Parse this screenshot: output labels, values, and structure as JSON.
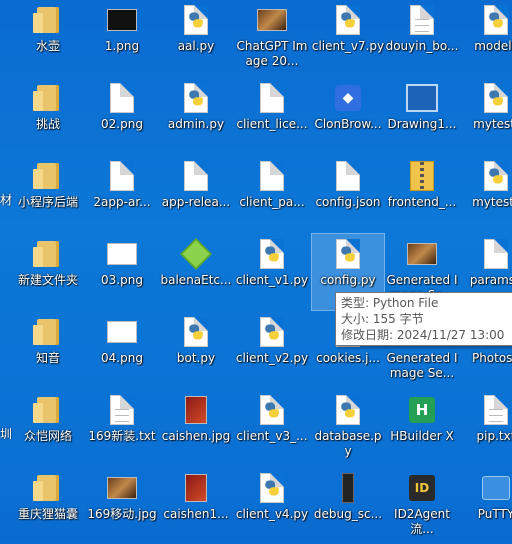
{
  "desktop": {
    "icons": [
      {
        "label": "水壶",
        "icon": "folder-icon",
        "type": "folder"
      },
      {
        "label": "1.png",
        "icon": "image-icon",
        "type": "img-dark"
      },
      {
        "label": "aal.py",
        "icon": "python-file-icon",
        "type": "py"
      },
      {
        "label": "ChatGPT Image 20...",
        "icon": "image-icon",
        "type": "img-photo"
      },
      {
        "label": "client_v7.py",
        "icon": "python-file-icon",
        "type": "py"
      },
      {
        "label": "douyin_bo...",
        "icon": "text-file-icon",
        "type": "doc-lines"
      },
      {
        "label": "models",
        "icon": "python-file-icon",
        "type": "py"
      },
      {
        "label": "挑战",
        "icon": "folder-icon",
        "type": "folder"
      },
      {
        "label": "02.png",
        "icon": "image-icon",
        "type": "doc"
      },
      {
        "label": "admin.py",
        "icon": "python-file-icon",
        "type": "py"
      },
      {
        "label": "client_lice...",
        "icon": "file-icon",
        "type": "doc"
      },
      {
        "label": "ClonBrow...",
        "icon": "app-icon",
        "type": "app-blue"
      },
      {
        "label": "Drawing1...",
        "icon": "drawing-file-icon",
        "type": "dwg"
      },
      {
        "label": "mytest.",
        "icon": "python-file-icon",
        "type": "py"
      },
      {
        "label": "小程序后端",
        "icon": "folder-icon",
        "type": "folder"
      },
      {
        "label": "2app-ar...",
        "icon": "file-icon",
        "type": "doc"
      },
      {
        "label": "app-relea...",
        "icon": "file-icon",
        "type": "doc"
      },
      {
        "label": "client_pa...",
        "icon": "file-icon",
        "type": "doc"
      },
      {
        "label": "config.json",
        "icon": "file-icon",
        "type": "doc"
      },
      {
        "label": "frontend_...",
        "icon": "zip-icon",
        "type": "zip"
      },
      {
        "label": "mytest_",
        "icon": "python-file-icon",
        "type": "py"
      },
      {
        "label": "新建文件夹",
        "icon": "folder-icon",
        "type": "folder"
      },
      {
        "label": "03.png",
        "icon": "image-icon",
        "type": "img"
      },
      {
        "label": "balenaEtc...",
        "icon": "balena-app-icon",
        "type": "cube"
      },
      {
        "label": "client_v1.py",
        "icon": "python-file-icon",
        "type": "py"
      },
      {
        "label": "config.py",
        "icon": "python-file-icon",
        "type": "py",
        "selected": true
      },
      {
        "label": "Generated Image Se...",
        "icon": "image-icon",
        "type": "img-photo"
      },
      {
        "label": "params.j",
        "icon": "file-icon",
        "type": "doc"
      },
      {
        "label": "知音",
        "icon": "folder-icon",
        "type": "folder"
      },
      {
        "label": "04.png",
        "icon": "image-icon",
        "type": "img"
      },
      {
        "label": "bot.py",
        "icon": "python-file-icon",
        "type": "py"
      },
      {
        "label": "client_v2.py",
        "icon": "python-file-icon",
        "type": "py"
      },
      {
        "label": "cookies.j...",
        "icon": "file-icon",
        "type": "doc"
      },
      {
        "label": "Generated Image Se...",
        "icon": "image-icon",
        "type": "img-photo"
      },
      {
        "label": "Photosh",
        "icon": "photoshop-icon",
        "type": "app-blue"
      },
      {
        "label": "众恺网络",
        "icon": "folder-icon",
        "type": "folder"
      },
      {
        "label": "169新装.txt",
        "icon": "text-file-icon",
        "type": "doc-lines"
      },
      {
        "label": "caishen.jpg",
        "icon": "image-icon",
        "type": "img-red"
      },
      {
        "label": "client_v3_...",
        "icon": "python-file-icon",
        "type": "py"
      },
      {
        "label": "database.py",
        "icon": "python-file-icon",
        "type": "py"
      },
      {
        "label": "HBuilder X",
        "icon": "hbuilder-icon",
        "type": "app-green"
      },
      {
        "label": "pip.txt",
        "icon": "text-file-icon",
        "type": "doc-lines"
      },
      {
        "label": "重庆狸猫囊",
        "icon": "folder-icon",
        "type": "folder"
      },
      {
        "label": "169移动.jpg",
        "icon": "image-icon",
        "type": "img-photo"
      },
      {
        "label": "caishen1...",
        "icon": "image-icon",
        "type": "img-red"
      },
      {
        "label": "client_v4.py",
        "icon": "python-file-icon",
        "type": "py"
      },
      {
        "label": "debug_sc...",
        "icon": "file-icon",
        "type": "black-bar"
      },
      {
        "label": "ID2Agent流...",
        "icon": "id-app-icon",
        "type": "id-app"
      },
      {
        "label": "PuTTY",
        "icon": "putty-icon",
        "type": "net"
      }
    ],
    "left_edge_fragments": [
      {
        "label": "材"
      },
      {
        "label": "圳"
      }
    ]
  },
  "tooltip": {
    "type_line": "类型: Python File",
    "size_line": "大小: 155 字节",
    "date_line": "修改日期: 2024/11/27 13:00"
  }
}
